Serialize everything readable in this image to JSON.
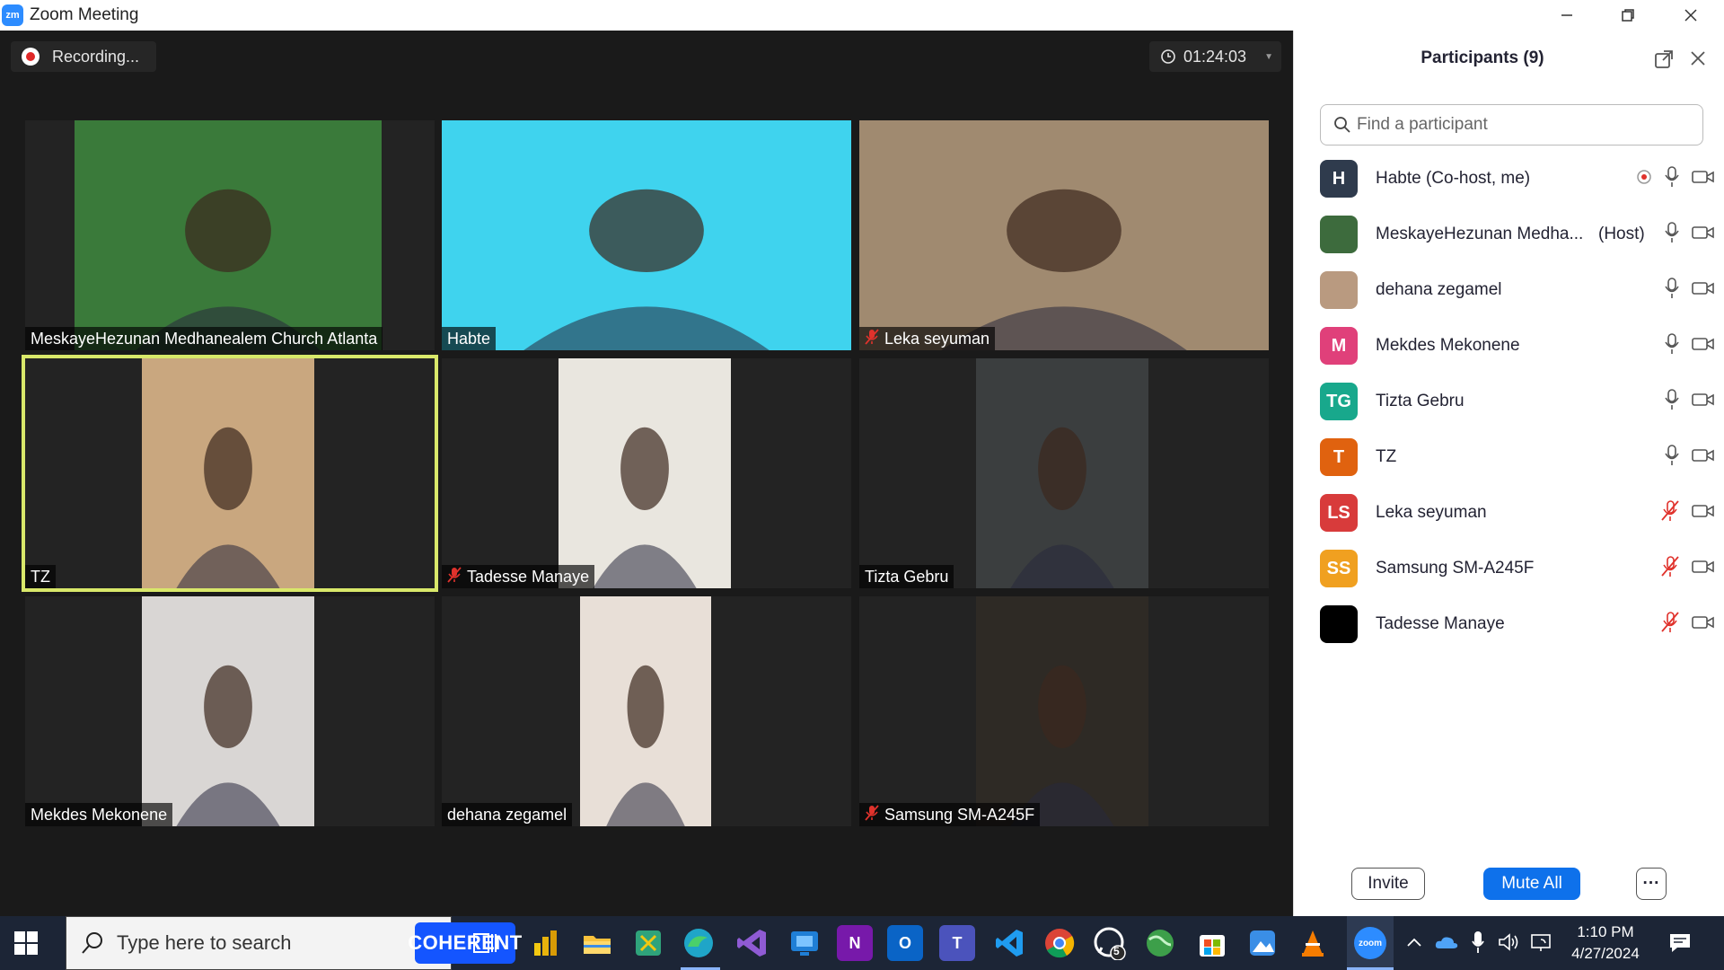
{
  "window": {
    "title": "Zoom Meeting",
    "logo_text": "zm"
  },
  "meeting": {
    "recording_label": "Recording...",
    "elapsed": "01:24:03",
    "tiles": [
      {
        "name": "MeskayeHezunan Medhanealem Church Atlanta",
        "muted": false,
        "active": false,
        "bg": "#3a7a3a"
      },
      {
        "name": "Habte",
        "muted": false,
        "active": false,
        "bg": "#3fd3ee"
      },
      {
        "name": "Leka seyuman",
        "muted": true,
        "active": false,
        "bg": "#a08a70"
      },
      {
        "name": "TZ",
        "muted": false,
        "active": true,
        "bg": "#c9a77f"
      },
      {
        "name": "Tadesse Manaye",
        "muted": true,
        "active": false,
        "bg": "#e9e6df"
      },
      {
        "name": "Tizta Gebru",
        "muted": false,
        "active": false,
        "bg": "#3b3e3f"
      },
      {
        "name": "Mekdes Mekonene",
        "muted": false,
        "active": false,
        "bg": "#d9d6d4"
      },
      {
        "name": "dehana zegamel",
        "muted": false,
        "active": false,
        "bg": "#e8dfd7"
      },
      {
        "name": "Samsung SM-A245F",
        "muted": true,
        "active": false,
        "bg": "#2e2a25"
      }
    ]
  },
  "panel": {
    "title": "Participants (9)",
    "search_placeholder": "Find a participant",
    "participants": [
      {
        "initials": "H",
        "name": "Habte (Co-host, me)",
        "tag": "",
        "color": "#2f3b4d",
        "recording": true,
        "mic_muted": false
      },
      {
        "initials": "",
        "name": "MeskayeHezunan Medha...",
        "tag": "(Host)",
        "color": "#3d6b3d",
        "recording": false,
        "mic_muted": false
      },
      {
        "initials": "",
        "name": "dehana zegamel",
        "tag": "",
        "color": "#b99a80",
        "recording": false,
        "mic_muted": false
      },
      {
        "initials": "M",
        "name": "Mekdes Mekonene",
        "tag": "",
        "color": "#e0407a",
        "recording": false,
        "mic_muted": false
      },
      {
        "initials": "TG",
        "name": "Tizta Gebru",
        "tag": "",
        "color": "#18a88c",
        "recording": false,
        "mic_muted": false
      },
      {
        "initials": "T",
        "name": "TZ",
        "tag": "",
        "color": "#e0620f",
        "recording": false,
        "mic_muted": false
      },
      {
        "initials": "LS",
        "name": "Leka seyuman",
        "tag": "",
        "color": "#d83b3b",
        "recording": false,
        "mic_muted": true
      },
      {
        "initials": "SS",
        "name": "Samsung SM-A245F",
        "tag": "",
        "color": "#f0a020",
        "recording": false,
        "mic_muted": true
      },
      {
        "initials": "",
        "name": "Tadesse Manaye",
        "tag": "",
        "color": "#000000",
        "recording": false,
        "mic_muted": true
      }
    ],
    "invite_label": "Invite",
    "mute_all_label": "Mute All",
    "more_label": "···"
  },
  "taskbar": {
    "search_text": "Type here to search",
    "coherent_label": "COHERENT",
    "time": "1:10 PM",
    "date": "4/27/2024",
    "whatsapp_badge": "5",
    "zoom_label": "zoom"
  }
}
